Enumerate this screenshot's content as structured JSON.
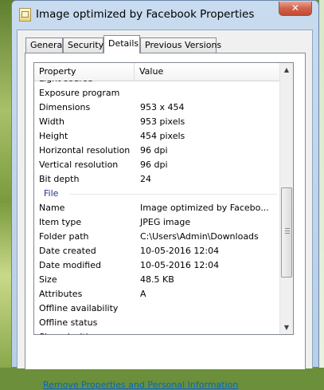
{
  "window": {
    "title": "Image optimized by Facebook Properties",
    "close_label": "✕"
  },
  "tabs": [
    {
      "label": "General",
      "active": false
    },
    {
      "label": "Security",
      "active": false
    },
    {
      "label": "Details",
      "active": true
    },
    {
      "label": "Previous Versions",
      "active": false
    }
  ],
  "details": {
    "columns": {
      "property": "Property",
      "value": "Value"
    },
    "rows": [
      {
        "type": "prop",
        "property": "Light source",
        "value": ""
      },
      {
        "type": "prop",
        "property": "Exposure program",
        "value": ""
      },
      {
        "type": "prop",
        "property": "Dimensions",
        "value": "953 x 454"
      },
      {
        "type": "prop",
        "property": "Width",
        "value": "953 pixels"
      },
      {
        "type": "prop",
        "property": "Height",
        "value": "454 pixels"
      },
      {
        "type": "prop",
        "property": "Horizontal resolution",
        "value": "96 dpi"
      },
      {
        "type": "prop",
        "property": "Vertical resolution",
        "value": "96 dpi"
      },
      {
        "type": "prop",
        "property": "Bit depth",
        "value": "24"
      },
      {
        "type": "group",
        "property": "File",
        "value": ""
      },
      {
        "type": "prop",
        "property": "Name",
        "value": "Image optimized by Facebo..."
      },
      {
        "type": "prop",
        "property": "Item type",
        "value": "JPEG image"
      },
      {
        "type": "prop",
        "property": "Folder path",
        "value": "C:\\Users\\Admin\\Downloads"
      },
      {
        "type": "prop",
        "property": "Date created",
        "value": "10-05-2016 12:04"
      },
      {
        "type": "prop",
        "property": "Date modified",
        "value": "10-05-2016 12:04"
      },
      {
        "type": "prop",
        "property": "Size",
        "value": "48.5 KB"
      },
      {
        "type": "prop",
        "property": "Attributes",
        "value": "A"
      },
      {
        "type": "prop",
        "property": "Offline availability",
        "value": ""
      },
      {
        "type": "prop",
        "property": "Offline status",
        "value": ""
      },
      {
        "type": "prop",
        "property": "Shared with",
        "value": ""
      }
    ],
    "scroll_position": 0.72
  },
  "footer": {
    "link_label": "Remove Properties and Personal Information"
  },
  "colors": {
    "group_header": "#1e3287",
    "link": "#0066cc"
  }
}
